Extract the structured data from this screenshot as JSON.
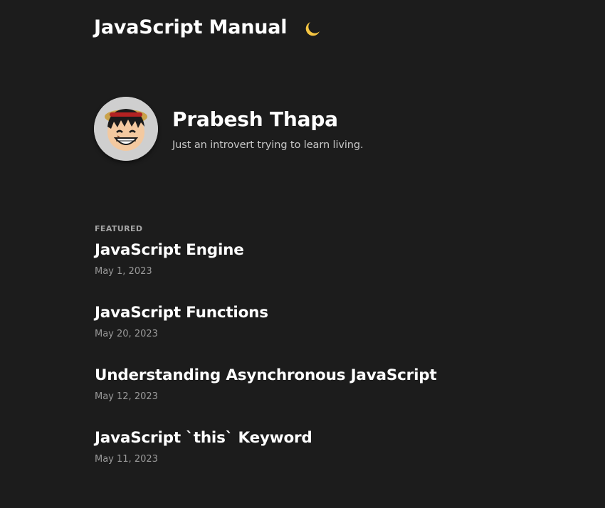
{
  "header": {
    "title": "JavaScript Manual",
    "theme_toggle_icon": "moon-icon"
  },
  "bio": {
    "avatar_icon": "avatar",
    "name": "Prabesh Thapa",
    "tagline": "Just an introvert trying to learn living."
  },
  "posts": {
    "featured_label": "FEATURED",
    "items": [
      {
        "title": "JavaScript Engine",
        "date": "May 1, 2023"
      },
      {
        "title": "JavaScript Functions",
        "date": "May 20, 2023"
      },
      {
        "title": "Understanding Asynchronous JavaScript",
        "date": "May 12, 2023"
      },
      {
        "title": "JavaScript `this` Keyword",
        "date": "May 11, 2023"
      }
    ]
  },
  "colors": {
    "background": "#1c1c1c",
    "text": "#ffffff",
    "muted": "#9a9a9a",
    "moon": "#f5c542"
  }
}
